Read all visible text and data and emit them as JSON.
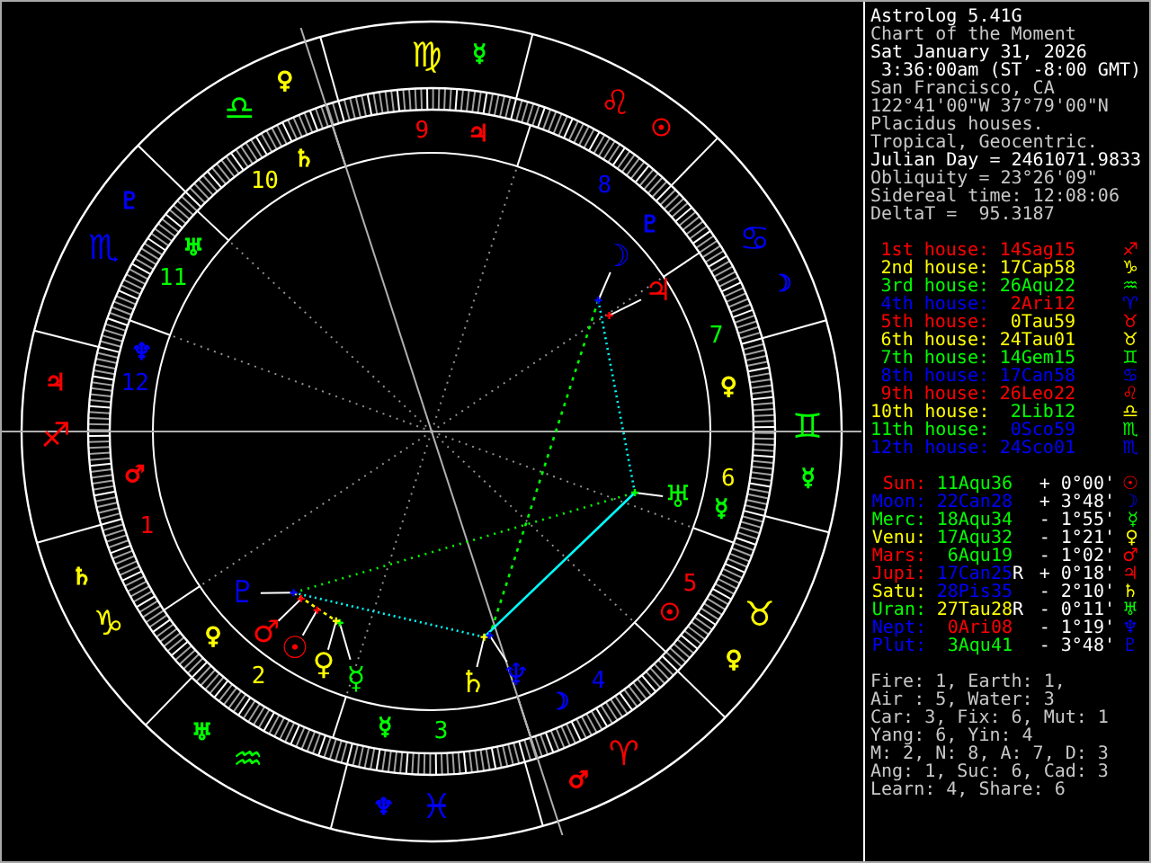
{
  "wheel": {
    "signs": [
      {
        "glyph": "♈",
        "color": "#ff0000",
        "ruler": {
          "glyph": "♂",
          "color": "#ff0000"
        }
      },
      {
        "glyph": "♉",
        "color": "#ffff00",
        "ruler": {
          "glyph": "♀",
          "color": "#ffff00"
        }
      },
      {
        "glyph": "♊",
        "color": "#00ff00",
        "ruler": {
          "glyph": "☿",
          "color": "#00ff00"
        }
      },
      {
        "glyph": "♋",
        "color": "#0000ff",
        "ruler": {
          "glyph": "☽",
          "color": "#0000ff"
        }
      },
      {
        "glyph": "♌",
        "color": "#ff0000",
        "ruler": {
          "glyph": "☉",
          "color": "#ff0000"
        }
      },
      {
        "glyph": "♍",
        "color": "#ffff00",
        "ruler": {
          "glyph": "☿",
          "color": "#00ff00"
        }
      },
      {
        "glyph": "♎",
        "color": "#00ff00",
        "ruler": {
          "glyph": "♀",
          "color": "#ffff00"
        }
      },
      {
        "glyph": "♏",
        "color": "#0000ff",
        "ruler": {
          "glyph": "♇",
          "color": "#0000ff"
        }
      },
      {
        "glyph": "♐",
        "color": "#ff0000",
        "ruler": {
          "glyph": "♃",
          "color": "#ff0000"
        }
      },
      {
        "glyph": "♑",
        "color": "#ffff00",
        "ruler": {
          "glyph": "♄",
          "color": "#ffff00"
        }
      },
      {
        "glyph": "♒",
        "color": "#00ff00",
        "ruler": {
          "glyph": "♅",
          "color": "#00ff00"
        }
      },
      {
        "glyph": "♓",
        "color": "#0000ff",
        "ruler": {
          "glyph": "♆",
          "color": "#0000ff"
        }
      }
    ],
    "houses": [
      {
        "number": "1",
        "color": "#ff0000",
        "ruler": {
          "glyph": "♂",
          "color": "#ff0000"
        }
      },
      {
        "number": "2",
        "color": "#ffff00",
        "ruler": {
          "glyph": "♀",
          "color": "#ffff00"
        }
      },
      {
        "number": "3",
        "color": "#00ff00",
        "ruler": {
          "glyph": "☿",
          "color": "#00ff00"
        }
      },
      {
        "number": "4",
        "color": "#0000ff",
        "ruler": {
          "glyph": "☽",
          "color": "#0000ff"
        }
      },
      {
        "number": "5",
        "color": "#ff0000",
        "ruler": {
          "glyph": "☉",
          "color": "#ff0000"
        }
      },
      {
        "number": "6",
        "color": "#ffff00",
        "ruler": {
          "glyph": "☿",
          "color": "#00ff00"
        }
      },
      {
        "number": "7",
        "color": "#00ff00",
        "ruler": {
          "glyph": "♀",
          "color": "#ffff00"
        }
      },
      {
        "number": "8",
        "color": "#0000ff",
        "ruler": {
          "glyph": "♇",
          "color": "#0000ff"
        }
      },
      {
        "number": "9",
        "color": "#ff0000",
        "ruler": {
          "glyph": "♃",
          "color": "#ff0000"
        }
      },
      {
        "number": "10",
        "color": "#ffff00",
        "ruler": {
          "glyph": "♄",
          "color": "#ffff00"
        }
      },
      {
        "number": "11",
        "color": "#00ff00",
        "ruler": {
          "glyph": "♅",
          "color": "#00ff00"
        }
      },
      {
        "number": "12",
        "color": "#0000ff",
        "ruler": {
          "glyph": "♆",
          "color": "#0000ff"
        }
      }
    ],
    "planets": [
      {
        "glyph": "☉",
        "color": "#ff0000"
      },
      {
        "glyph": "☽",
        "color": "#0000ff"
      },
      {
        "glyph": "☿",
        "color": "#00ff00"
      },
      {
        "glyph": "♀",
        "color": "#ffff00"
      },
      {
        "glyph": "♂",
        "color": "#ff0000"
      },
      {
        "glyph": "♃",
        "color": "#ff0000"
      },
      {
        "glyph": "♄",
        "color": "#ffff00"
      },
      {
        "glyph": "♅",
        "color": "#00ff00"
      },
      {
        "glyph": "♆",
        "color": "#0000ff"
      },
      {
        "glyph": "♇",
        "color": "#0000ff"
      }
    ]
  },
  "info": [
    {
      "text": "Astrolog 5.41G",
      "kind": "bright"
    },
    {
      "text": "Chart of the Moment",
      "kind": "dim"
    },
    {
      "text": "Sat January 31, 2026",
      "kind": "bright"
    },
    {
      "text": " 3:36:00am (ST -8:00 GMT)",
      "kind": "bright"
    },
    {
      "text": "San Francisco, CA",
      "kind": "dim"
    },
    {
      "text": "122°41'00\"W 37°79'00\"N",
      "kind": "dim"
    },
    {
      "text": "Placidus houses.",
      "kind": "dim"
    },
    {
      "text": "Tropical, Geocentric.",
      "kind": "dim"
    },
    {
      "text": "Julian Day = 2461071.9833",
      "kind": "bright"
    },
    {
      "text": "Obliquity = 23°26'09\"",
      "kind": "dim"
    },
    {
      "text": "Sidereal time: 12:08:06",
      "kind": "dim"
    },
    {
      "text": "DeltaT =  95.3187",
      "kind": "dim"
    }
  ],
  "houses": [
    {
      "label": "1st house:",
      "glyph": "♐",
      "color": "#ff0000",
      "position": {
        "text": "14Sag15",
        "color": "#ff0000"
      }
    },
    {
      "label": "2nd house:",
      "glyph": "♑",
      "color": "#ffff00",
      "position": {
        "text": "17Cap58",
        "color": "#ffff00"
      }
    },
    {
      "label": "3rd house:",
      "glyph": "♒",
      "color": "#00ff00",
      "position": {
        "text": "26Aqu22",
        "color": "#00ff00"
      }
    },
    {
      "label": "4th house:",
      "glyph": "♈",
      "color": "#0000ff",
      "position": {
        "text": "2Ari12",
        "color": "#ff0000"
      }
    },
    {
      "label": "5th house:",
      "glyph": "♉",
      "color": "#ff0000",
      "position": {
        "text": "0Tau59",
        "color": "#ffff00"
      }
    },
    {
      "label": "6th house:",
      "glyph": "♉",
      "color": "#ffff00",
      "position": {
        "text": "24Tau01",
        "color": "#ffff00"
      }
    },
    {
      "label": "7th house:",
      "glyph": "♊",
      "color": "#00ff00",
      "position": {
        "text": "14Gem15",
        "color": "#00ff00"
      }
    },
    {
      "label": "8th house:",
      "glyph": "♋",
      "color": "#0000ff",
      "position": {
        "text": "17Can58",
        "color": "#0000ff"
      }
    },
    {
      "label": "9th house:",
      "glyph": "♌",
      "color": "#ff0000",
      "position": {
        "text": "26Leo22",
        "color": "#ff0000"
      }
    },
    {
      "label": "10th house:",
      "glyph": "♎",
      "color": "#ffff00",
      "position": {
        "text": "2Lib12",
        "color": "#00ff00"
      }
    },
    {
      "label": "11th house:",
      "glyph": "♏",
      "color": "#00ff00",
      "position": {
        "text": "0Sco59",
        "color": "#0000ff"
      }
    },
    {
      "label": "12th house:",
      "glyph": "♏",
      "color": "#0000ff",
      "position": {
        "text": "24Sco01",
        "color": "#0000ff"
      }
    }
  ],
  "planets": [
    {
      "name": "Sun:",
      "latitude": "+ 0°00'",
      "glyph": "☉",
      "color": "#ff0000",
      "position": {
        "text": "11Aqu36",
        "color": "#00ff00"
      }
    },
    {
      "name": "Moon:",
      "latitude": "+ 3°48'",
      "glyph": "☽",
      "color": "#0000ff",
      "position": {
        "text": "22Can28",
        "color": "#0000ff"
      }
    },
    {
      "name": "Merc:",
      "latitude": "- 1°55'",
      "glyph": "☿",
      "color": "#00ff00",
      "position": {
        "text": "18Aqu34",
        "color": "#00ff00"
      }
    },
    {
      "name": "Venu:",
      "latitude": "- 1°21'",
      "glyph": "♀",
      "color": "#ffff00",
      "position": {
        "text": "17Aqu32",
        "color": "#00ff00"
      }
    },
    {
      "name": "Mars:",
      "latitude": "- 1°02'",
      "glyph": "♂",
      "color": "#ff0000",
      "position": {
        "text": "6Aqu19",
        "color": "#00ff00"
      }
    },
    {
      "name": "Jupi:",
      "retrograde": "R",
      "latitude": "+ 0°18'",
      "glyph": "♃",
      "color": "#ff0000",
      "position": {
        "text": "17Can25",
        "color": "#0000ff"
      }
    },
    {
      "name": "Satu:",
      "latitude": "- 2°10'",
      "glyph": "♄",
      "color": "#ffff00",
      "position": {
        "text": "28Pis35",
        "color": "#0000ff"
      }
    },
    {
      "name": "Uran:",
      "retrograde": "R",
      "latitude": "- 0°11'",
      "glyph": "♅",
      "color": "#00ff00",
      "position": {
        "text": "27Tau28",
        "color": "#ffff00"
      }
    },
    {
      "name": "Nept:",
      "latitude": "- 1°19'",
      "glyph": "♆",
      "color": "#0000ff",
      "position": {
        "text": "0Ari08",
        "color": "#ff0000"
      }
    },
    {
      "name": "Plut:",
      "latitude": "- 3°48'",
      "glyph": "♇",
      "color": "#0000ff",
      "position": {
        "text": "3Aqu41",
        "color": "#00ff00"
      }
    }
  ],
  "summary": [
    "Fire: 1, Earth: 1,",
    "Air : 5, Water: 3",
    "Car: 3, Fix: 6, Mut: 1",
    "Yang: 6, Yin: 4",
    "M: 2, N: 8, A: 7, D: 3",
    "Ang: 1, Suc: 6, Cad: 3",
    "Learn: 4, Share: 6"
  ]
}
